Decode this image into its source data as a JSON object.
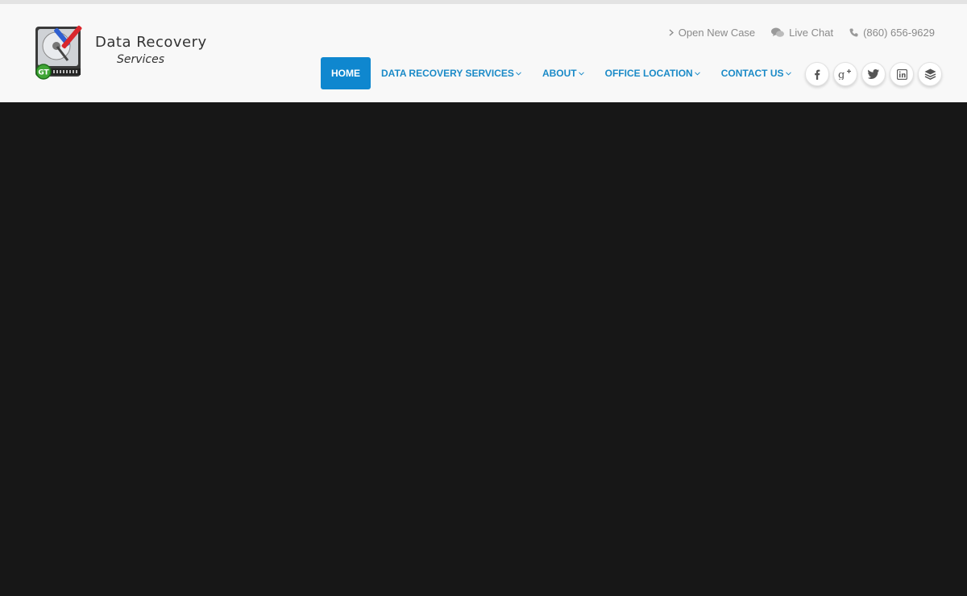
{
  "brand": {
    "title": "Data Recovery",
    "subtitle": "Services",
    "badge": "GT"
  },
  "toplinks": [
    {
      "label": "Open New Case",
      "icon": "chevron-right-icon"
    },
    {
      "label": "Live Chat",
      "icon": "chat-icon"
    },
    {
      "label": "(860) 656-9629",
      "icon": "phone-icon"
    }
  ],
  "nav": [
    {
      "label": "HOME",
      "active": true
    },
    {
      "label": "DATA RECOVERY SERVICES",
      "dropdown": true
    },
    {
      "label": "ABOUT",
      "dropdown": true
    },
    {
      "label": "OFFICE LOCATION",
      "dropdown": true
    },
    {
      "label": "CONTACT US",
      "dropdown": true
    }
  ],
  "social": [
    "facebook-icon",
    "google-plus-icon",
    "twitter-icon",
    "linkedin-icon",
    "layers-icon"
  ],
  "colors": {
    "accent": "#0f87cf",
    "nav_text": "#1a8ac7",
    "header_bg": "#f8f8f8",
    "hero_bg": "#171717"
  }
}
